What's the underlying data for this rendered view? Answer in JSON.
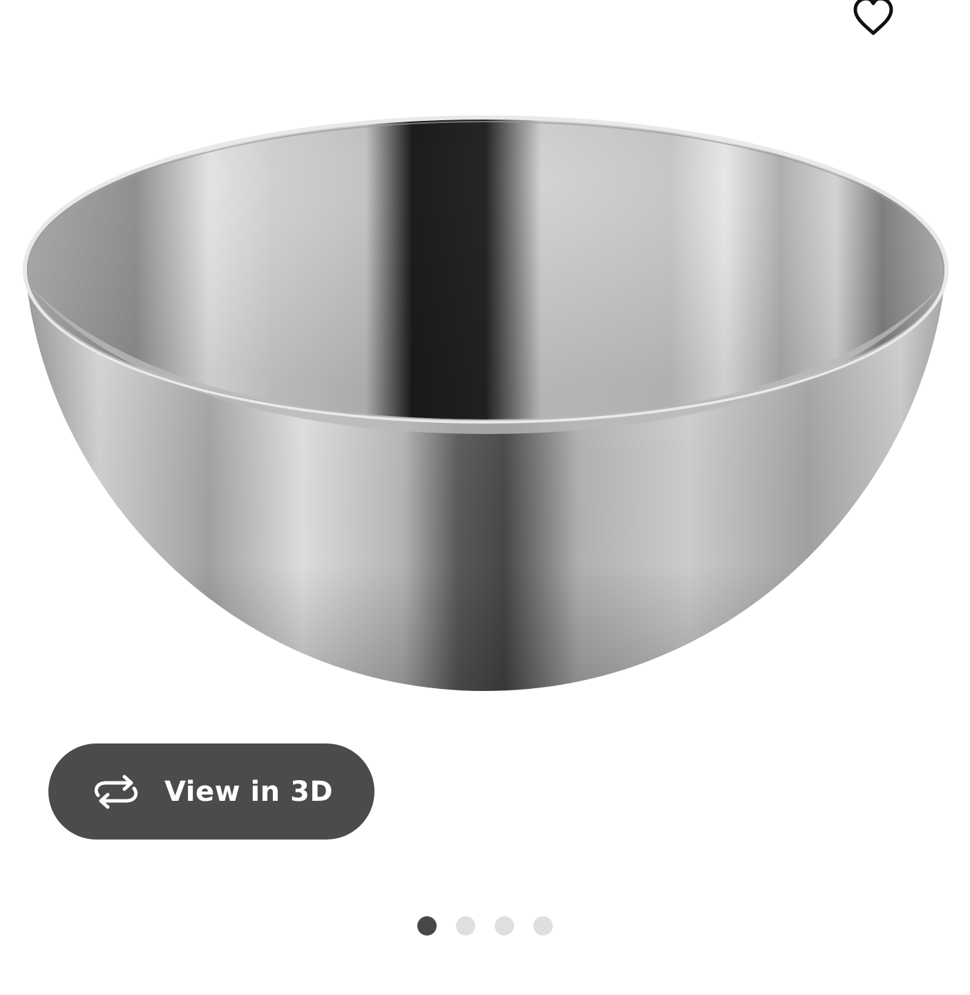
{
  "product_image": {
    "alt": "",
    "icon": "stainless-steel-bowl"
  },
  "favorite": {
    "icon": "heart-outline-icon"
  },
  "view_3d": {
    "label": "View in 3D",
    "icon": "rotate-3d-icon",
    "background": "#4b4b4b",
    "text_color": "#ffffff"
  },
  "carousel": {
    "total_pages": 4,
    "current_page": 1,
    "active_color": "#484848",
    "inactive_color": "#dfdfdf"
  }
}
